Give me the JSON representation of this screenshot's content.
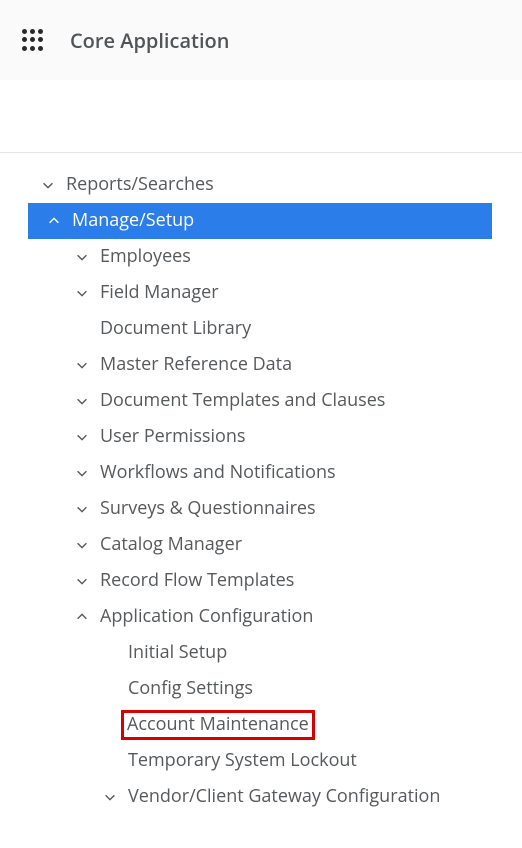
{
  "header": {
    "title": "Core Application"
  },
  "tree": {
    "reports_searches": "Reports/Searches",
    "manage_setup": "Manage/Setup",
    "manage_setup_children": {
      "employees": "Employees",
      "field_manager": "Field Manager",
      "document_library": "Document Library",
      "master_reference_data": "Master Reference Data",
      "document_templates_clauses": "Document Templates and Clauses",
      "user_permissions": "User Permissions",
      "workflows_notifications": "Workflows and Notifications",
      "surveys_questionnaires": "Surveys & Questionnaires",
      "catalog_manager": "Catalog Manager",
      "record_flow_templates": "Record Flow Templates",
      "application_configuration": "Application Configuration",
      "application_configuration_children": {
        "initial_setup": "Initial Setup",
        "config_settings": "Config Settings",
        "account_maintenance": "Account Maintenance",
        "temporary_system_lockout": "Temporary System Lockout",
        "vendor_client_gateway_config": "Vendor/Client Gateway Configuration"
      }
    }
  },
  "colors": {
    "selected_bg": "#2b7de9",
    "highlight_border": "#d40202"
  }
}
